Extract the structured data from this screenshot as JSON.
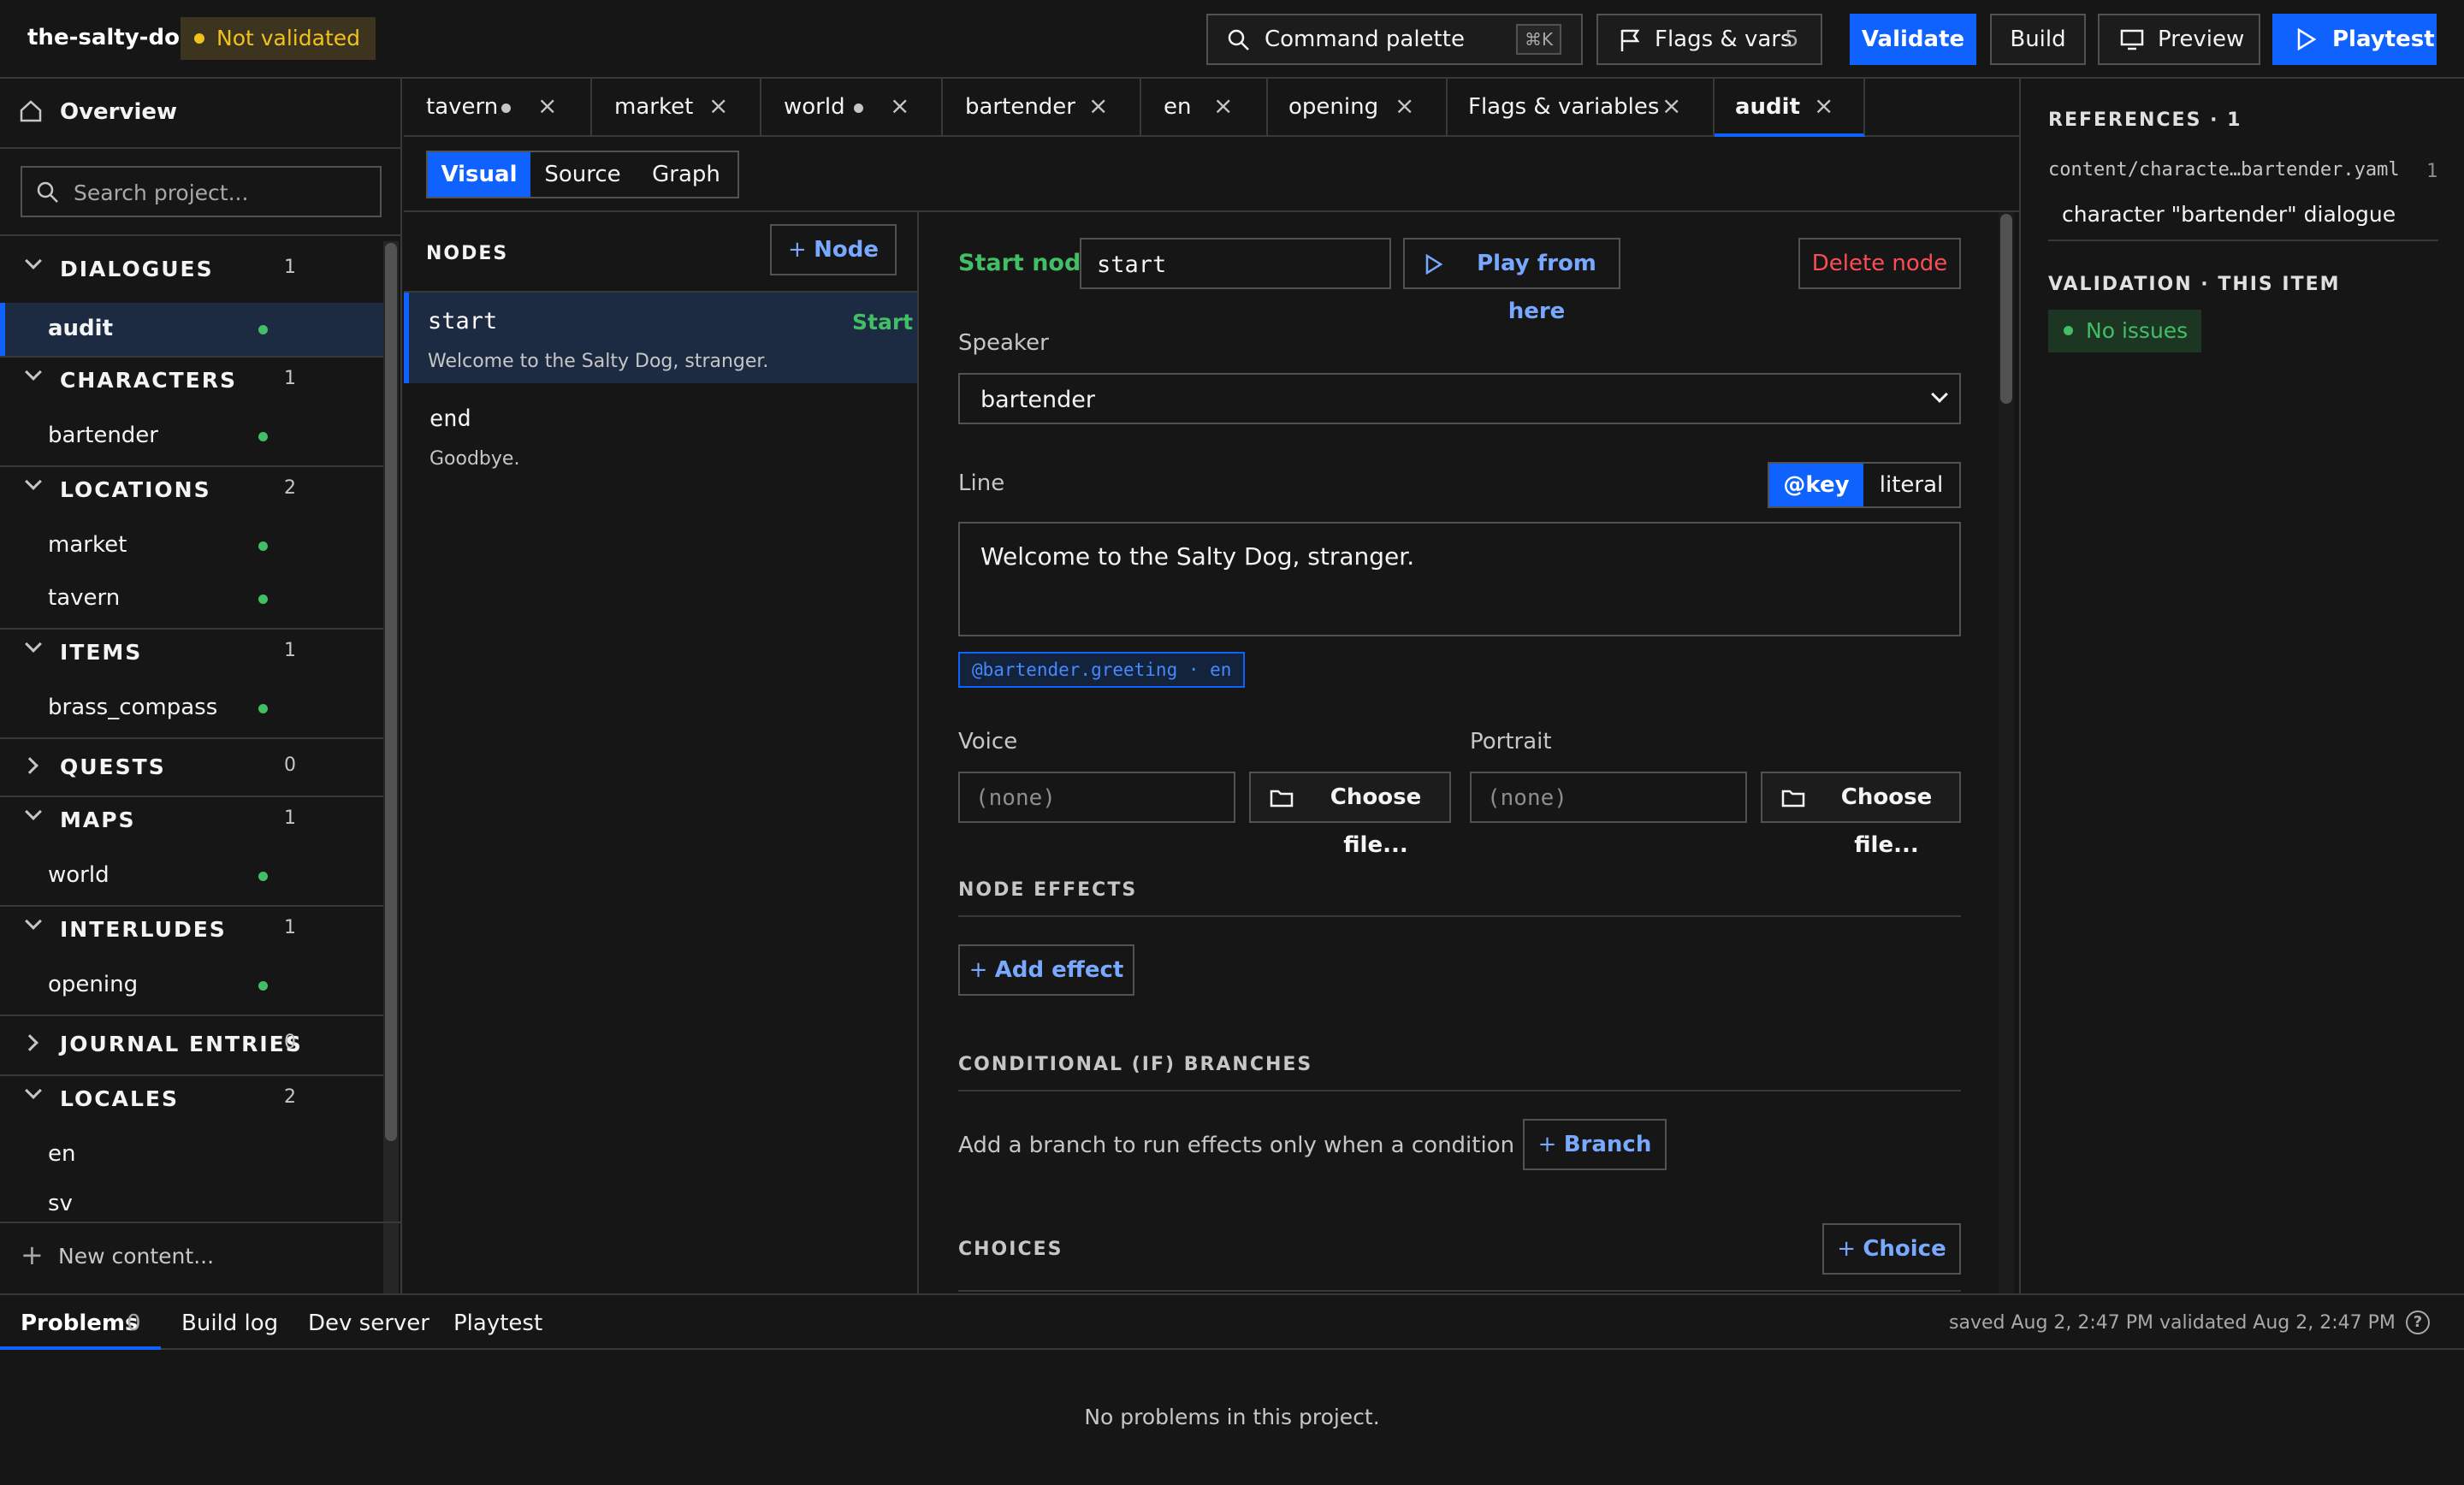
{
  "header": {
    "project_name": "the-salty-dog",
    "validation_badge": "Not validated",
    "command_palette": "Command palette",
    "command_shortcut": "⌘K",
    "flags_label": "Flags & vars",
    "flags_count": "5",
    "validate_label": "Validate",
    "build_label": "Build",
    "preview_label": "Preview",
    "playtest_label": "Playtest"
  },
  "sidebar": {
    "overview": "Overview",
    "search_placeholder": "Search project...",
    "groups": [
      {
        "title": "DIALOGUES",
        "count": "1",
        "items": [
          "audit"
        ]
      },
      {
        "title": "CHARACTERS",
        "count": "1",
        "items": [
          "bartender"
        ]
      },
      {
        "title": "LOCATIONS",
        "count": "2",
        "items": [
          "market",
          "tavern"
        ]
      },
      {
        "title": "ITEMS",
        "count": "1",
        "items": [
          "brass_compass"
        ]
      },
      {
        "title": "QUESTS",
        "count": "0",
        "items": []
      },
      {
        "title": "MAPS",
        "count": "1",
        "items": [
          "world"
        ]
      },
      {
        "title": "INTERLUDES",
        "count": "1",
        "items": [
          "opening"
        ]
      },
      {
        "title": "JOURNAL ENTRIES",
        "count": "0",
        "items": []
      },
      {
        "title": "LOCALES",
        "count": "2",
        "items": [
          "en",
          "sv"
        ]
      }
    ],
    "new_content": "New content..."
  },
  "tabs": [
    {
      "label": "tavern",
      "dirty": true
    },
    {
      "label": "market",
      "dirty": false
    },
    {
      "label": "world",
      "dirty": true
    },
    {
      "label": "bartender",
      "dirty": false
    },
    {
      "label": "en",
      "dirty": false
    },
    {
      "label": "opening",
      "dirty": false
    },
    {
      "label": "Flags & variables",
      "dirty": false
    },
    {
      "label": "audit",
      "dirty": false,
      "active": true
    }
  ],
  "view_modes": [
    "Visual",
    "Source",
    "Graph"
  ],
  "nodes": {
    "heading": "NODES",
    "add_label": "Node",
    "list": [
      {
        "id": "start",
        "text": "Welcome to the Salty Dog, stranger.",
        "tag": "Start"
      },
      {
        "id": "end",
        "text": "Goodbye.",
        "tag": ""
      }
    ]
  },
  "editor": {
    "start_node_label": "Start node",
    "start_node_value": "start",
    "play_from_here": "Play from here",
    "delete_node": "Delete node",
    "speaker_label": "Speaker",
    "speaker_value": "bartender",
    "line_label": "Line",
    "line_mode_key": "@key",
    "line_mode_literal": "literal",
    "line_value": "Welcome to the Salty Dog, stranger.",
    "line_key_chip": "@bartender.greeting · en",
    "voice_label": "Voice",
    "voice_value": "(none)",
    "portrait_label": "Portrait",
    "portrait_value": "(none)",
    "choose_file": "Choose file...",
    "node_effects_title": "NODE EFFECTS",
    "add_effect": "Add effect",
    "branches_title": "CONDITIONAL (IF) BRANCHES",
    "branches_hint": "Add a branch to run effects only when a condition passes.",
    "branch_button": "Branch",
    "choices_title": "CHOICES",
    "choice_button": "Choice"
  },
  "references": {
    "title": "REFERENCES · 1",
    "path": "content/characte…bartender.yaml",
    "line": "1",
    "desc": "character \"bartender\" dialogue",
    "validation_title": "VALIDATION · THIS ITEM",
    "no_issues": "No issues"
  },
  "bottom": {
    "tabs": [
      {
        "label": "Problems",
        "count": "0"
      },
      {
        "label": "Build log"
      },
      {
        "label": "Dev server"
      },
      {
        "label": "Playtest"
      }
    ],
    "saved": "saved Aug 2, 2:47 PM",
    "validated": "validated Aug 2, 2:47 PM",
    "empty": "No problems in this project."
  },
  "colors": {
    "accent": "#0f62fe",
    "success": "#42be65",
    "warning": "#f1c21b",
    "danger": "#fa4d56"
  }
}
